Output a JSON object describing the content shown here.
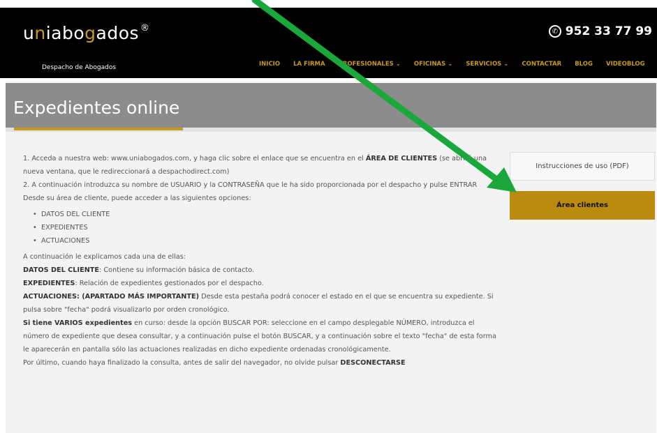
{
  "header": {
    "logo_text_pre": "u",
    "logo_text_acc1": "n",
    "logo_text_mid": "iabo",
    "logo_text_acc2": "g",
    "logo_text_post": "ados",
    "logo_reg": "®",
    "tagline": "Despacho de Abogados",
    "phone": "952 33 77 99",
    "nav": [
      "INICIO",
      "LA FIRMA",
      "PROFESIONALES ⌄",
      "OFICINAS ⌄",
      "SERVICIOS ⌄",
      "CONTACTAR",
      "BLOG",
      "VIDEOBLOG"
    ]
  },
  "page": {
    "title": "Expedientes online"
  },
  "sidebar": {
    "pdf_label": "Instrucciones de uso (PDF)",
    "area_label": "Área clientes"
  },
  "content": {
    "p1_a": "1. Acceda a nuestra web: www.uniabogados.com, y haga clic sobre el enlace que se encuentra en el ",
    "p1_b": "ÁREA DE CLIENTES",
    "p1_c": " (se abrirá una nueva ventana, que le redireccionará a despachodirect.com)",
    "p2": "2. A continuación introduzca su nombre de USUARIO y la CONTRASEÑA que le ha sido proporcionada por el despacho y pulse ENTRAR",
    "p3": "Desde su área de cliente, puede acceder a las siguientes opciones:",
    "list": [
      "DATOS DEL CLIENTE",
      "EXPEDIENTES",
      "ACTUACIONES"
    ],
    "p4": "A continuación le explicamos cada una de ellas:",
    "d1_b": "DATOS DEL CLIENTE",
    "d1_t": ": Contiene su información básica de contacto.",
    "d2_b": "EXPEDIENTES",
    "d2_t": ": Relación de expedientes gestionados por el despacho.",
    "d3_b1": "ACTUACIONES",
    "d3_sep": ": ",
    "d3_b2": "(APARTADO MÁS IMPORTANTE)",
    "d3_t": " Desde esta pestaña podrá conocer el estado en el que se encuentra su expediente. Si pulsa sobre \"fecha\" podrá visualizarlo por orden cronológico.",
    "d4_b": "Si tiene VARIOS expedientes",
    "d4_t": " en curso: desde la opción BUSCAR POR: seleccione en el campo desplegable NÚMERO, introduzca el número de expediente que desea consultar, y a continuación pulse el botón BUSCAR, y a continuación sobre el texto \"fecha\" de esta forma le aparecerán en pantalla sólo las actuaciones realizadas en dicho expediente ordenadas cronológicamente.",
    "p5_t": "Por último, cuando haya finalizado la consulta, antes de salir del navegador, no olvide pulsar ",
    "p5_b": "DESCONECTARSE"
  },
  "colors": {
    "accent": "#c79a1b",
    "arrow": "#1aa83c"
  }
}
